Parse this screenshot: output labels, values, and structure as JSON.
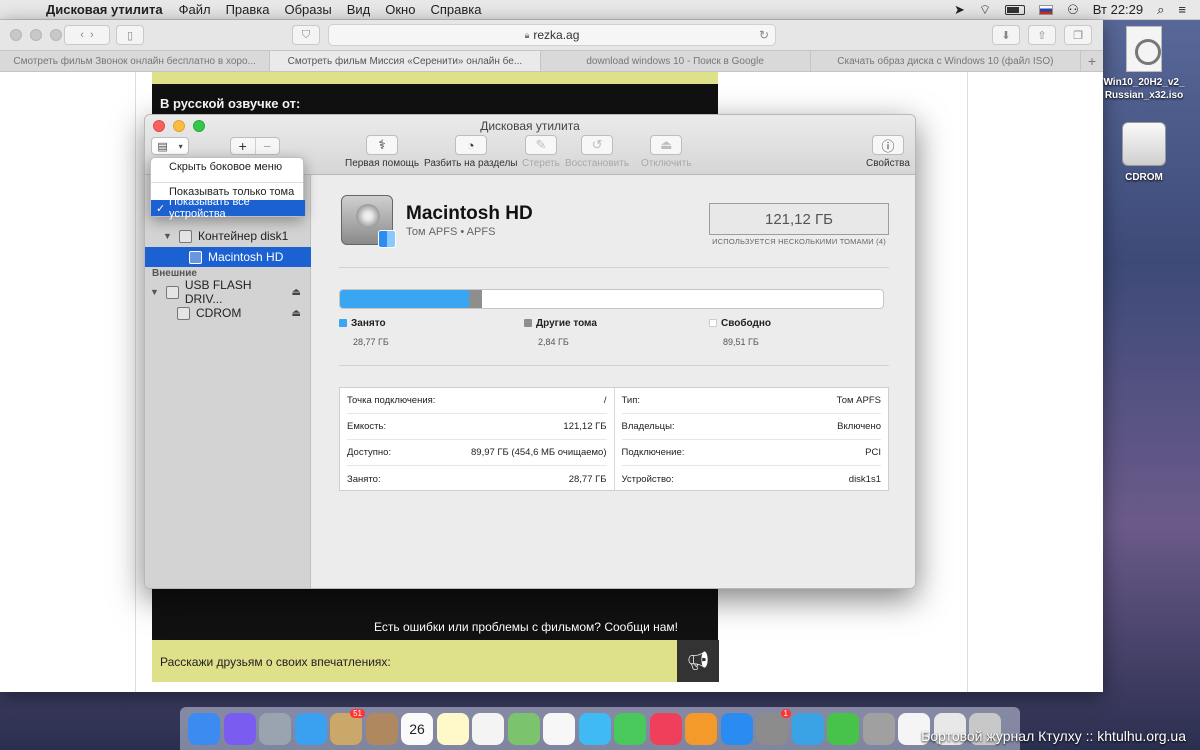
{
  "menubar": {
    "apple": "",
    "app": "Дисковая утилита",
    "items": [
      "Файл",
      "Правка",
      "Образы",
      "Вид",
      "Окно",
      "Справка"
    ],
    "clock": "Вт 22:29"
  },
  "safari": {
    "address": "rezka.ag",
    "tabs": [
      "Смотреть фильм Звонок онлайн бесплатно в хоро...",
      "Смотреть фильм Миссия «Серенити» онлайн бе...",
      "download windows 10 - Поиск в Google",
      "Скачать образ диска с Windows 10 (файл ISO)"
    ],
    "page": {
      "dub_header": "В русской озвучке от:",
      "report": "Есть ошибки или проблемы с фильмом? Сообщи нам!",
      "share": "Расскажи друзьям о своих впечатлениях:"
    }
  },
  "desktop": {
    "iso_label": "Win10_20H2_v2_Russian_x32.iso",
    "cdrom_label": "CDROM"
  },
  "disk_utility": {
    "title": "Дисковая утилита",
    "toolbar": {
      "first_aid": "Первая помощь",
      "partition": "Разбить на разделы",
      "erase": "Стереть",
      "restore": "Восстановить",
      "unmount": "Отключить",
      "info": "Свойства"
    },
    "view_menu": {
      "hide_sidebar": "Скрыть боковое меню",
      "show_volumes": "Показывать только тома",
      "show_all": "Показывать все устройства",
      "check": "✓"
    },
    "sidebar": {
      "container": "Контейнер disk1",
      "selected_volume": "Macintosh HD",
      "external_header": "Внешние",
      "usb": "USB FLASH DRIV...",
      "cdrom": "CDROM"
    },
    "volume": {
      "name": "Macintosh HD",
      "subtitle": "Том APFS • APFS",
      "capacity": "121,12 ГБ",
      "capacity_note": "ИСПОЛЬЗУЕТСЯ НЕСКОЛЬКИМИ ТОМАМИ (4)"
    },
    "usage": {
      "used_fraction": 0.2375,
      "other_fraction": 0.0234,
      "used_color": "#3aa6f2",
      "other_color": "#8e8e8e",
      "legend": [
        {
          "label": "Занято",
          "value": "28,77 ГБ"
        },
        {
          "label": "Другие тома",
          "value": "2,84 ГБ"
        },
        {
          "label": "Свободно",
          "value": "89,51 ГБ"
        }
      ]
    },
    "info": {
      "left": [
        {
          "k": "Точка подключения:",
          "v": "/"
        },
        {
          "k": "Емкость:",
          "v": "121,12 ГБ"
        },
        {
          "k": "Доступно:",
          "v": "89,97 ГБ (454,6 МБ очищаемо)"
        },
        {
          "k": "Занято:",
          "v": "28,77 ГБ"
        }
      ],
      "right": [
        {
          "k": "Тип:",
          "v": "Том APFS"
        },
        {
          "k": "Владельцы:",
          "v": "Включено"
        },
        {
          "k": "Подключение:",
          "v": "PCI"
        },
        {
          "k": "Устройство:",
          "v": "disk1s1"
        }
      ]
    }
  },
  "dock": {
    "calendar_day": "26",
    "badge_photos": "51",
    "badge_prefs": "1",
    "apps": [
      "finder-icon",
      "siri-icon",
      "launchpad-icon",
      "safari-icon",
      "mail-icon",
      "contacts-icon",
      "calendar-icon",
      "notes-icon",
      "reminders-icon",
      "maps-icon",
      "photos-icon",
      "messages-icon",
      "facetime-icon",
      "music-icon",
      "books-icon",
      "appstore-icon",
      "prefs-icon",
      "telegram-icon",
      "games-icon",
      "diskutility-icon",
      "documents-icon",
      "windows-icon",
      "trash-icon"
    ]
  },
  "watermark": "Бортовой журнал Ктулху :: khtulhu.org.ua"
}
